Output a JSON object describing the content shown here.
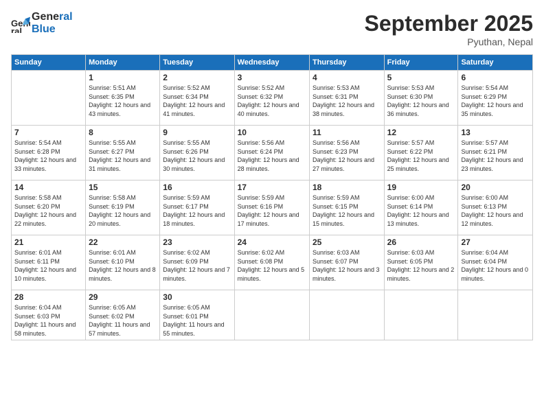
{
  "logo": {
    "line1": "General",
    "line2": "Blue"
  },
  "title": "September 2025",
  "subtitle": "Pyuthan, Nepal",
  "days_of_week": [
    "Sunday",
    "Monday",
    "Tuesday",
    "Wednesday",
    "Thursday",
    "Friday",
    "Saturday"
  ],
  "weeks": [
    [
      {
        "day": "",
        "info": ""
      },
      {
        "day": "1",
        "info": "Sunrise: 5:51 AM\nSunset: 6:35 PM\nDaylight: 12 hours\nand 43 minutes."
      },
      {
        "day": "2",
        "info": "Sunrise: 5:52 AM\nSunset: 6:34 PM\nDaylight: 12 hours\nand 41 minutes."
      },
      {
        "day": "3",
        "info": "Sunrise: 5:52 AM\nSunset: 6:32 PM\nDaylight: 12 hours\nand 40 minutes."
      },
      {
        "day": "4",
        "info": "Sunrise: 5:53 AM\nSunset: 6:31 PM\nDaylight: 12 hours\nand 38 minutes."
      },
      {
        "day": "5",
        "info": "Sunrise: 5:53 AM\nSunset: 6:30 PM\nDaylight: 12 hours\nand 36 minutes."
      },
      {
        "day": "6",
        "info": "Sunrise: 5:54 AM\nSunset: 6:29 PM\nDaylight: 12 hours\nand 35 minutes."
      }
    ],
    [
      {
        "day": "7",
        "info": "Sunrise: 5:54 AM\nSunset: 6:28 PM\nDaylight: 12 hours\nand 33 minutes."
      },
      {
        "day": "8",
        "info": "Sunrise: 5:55 AM\nSunset: 6:27 PM\nDaylight: 12 hours\nand 31 minutes."
      },
      {
        "day": "9",
        "info": "Sunrise: 5:55 AM\nSunset: 6:26 PM\nDaylight: 12 hours\nand 30 minutes."
      },
      {
        "day": "10",
        "info": "Sunrise: 5:56 AM\nSunset: 6:24 PM\nDaylight: 12 hours\nand 28 minutes."
      },
      {
        "day": "11",
        "info": "Sunrise: 5:56 AM\nSunset: 6:23 PM\nDaylight: 12 hours\nand 27 minutes."
      },
      {
        "day": "12",
        "info": "Sunrise: 5:57 AM\nSunset: 6:22 PM\nDaylight: 12 hours\nand 25 minutes."
      },
      {
        "day": "13",
        "info": "Sunrise: 5:57 AM\nSunset: 6:21 PM\nDaylight: 12 hours\nand 23 minutes."
      }
    ],
    [
      {
        "day": "14",
        "info": "Sunrise: 5:58 AM\nSunset: 6:20 PM\nDaylight: 12 hours\nand 22 minutes."
      },
      {
        "day": "15",
        "info": "Sunrise: 5:58 AM\nSunset: 6:19 PM\nDaylight: 12 hours\nand 20 minutes."
      },
      {
        "day": "16",
        "info": "Sunrise: 5:59 AM\nSunset: 6:17 PM\nDaylight: 12 hours\nand 18 minutes."
      },
      {
        "day": "17",
        "info": "Sunrise: 5:59 AM\nSunset: 6:16 PM\nDaylight: 12 hours\nand 17 minutes."
      },
      {
        "day": "18",
        "info": "Sunrise: 5:59 AM\nSunset: 6:15 PM\nDaylight: 12 hours\nand 15 minutes."
      },
      {
        "day": "19",
        "info": "Sunrise: 6:00 AM\nSunset: 6:14 PM\nDaylight: 12 hours\nand 13 minutes."
      },
      {
        "day": "20",
        "info": "Sunrise: 6:00 AM\nSunset: 6:13 PM\nDaylight: 12 hours\nand 12 minutes."
      }
    ],
    [
      {
        "day": "21",
        "info": "Sunrise: 6:01 AM\nSunset: 6:11 PM\nDaylight: 12 hours\nand 10 minutes."
      },
      {
        "day": "22",
        "info": "Sunrise: 6:01 AM\nSunset: 6:10 PM\nDaylight: 12 hours\nand 8 minutes."
      },
      {
        "day": "23",
        "info": "Sunrise: 6:02 AM\nSunset: 6:09 PM\nDaylight: 12 hours\nand 7 minutes."
      },
      {
        "day": "24",
        "info": "Sunrise: 6:02 AM\nSunset: 6:08 PM\nDaylight: 12 hours\nand 5 minutes."
      },
      {
        "day": "25",
        "info": "Sunrise: 6:03 AM\nSunset: 6:07 PM\nDaylight: 12 hours\nand 3 minutes."
      },
      {
        "day": "26",
        "info": "Sunrise: 6:03 AM\nSunset: 6:05 PM\nDaylight: 12 hours\nand 2 minutes."
      },
      {
        "day": "27",
        "info": "Sunrise: 6:04 AM\nSunset: 6:04 PM\nDaylight: 12 hours\nand 0 minutes."
      }
    ],
    [
      {
        "day": "28",
        "info": "Sunrise: 6:04 AM\nSunset: 6:03 PM\nDaylight: 11 hours\nand 58 minutes."
      },
      {
        "day": "29",
        "info": "Sunrise: 6:05 AM\nSunset: 6:02 PM\nDaylight: 11 hours\nand 57 minutes."
      },
      {
        "day": "30",
        "info": "Sunrise: 6:05 AM\nSunset: 6:01 PM\nDaylight: 11 hours\nand 55 minutes."
      },
      {
        "day": "",
        "info": ""
      },
      {
        "day": "",
        "info": ""
      },
      {
        "day": "",
        "info": ""
      },
      {
        "day": "",
        "info": ""
      }
    ]
  ]
}
